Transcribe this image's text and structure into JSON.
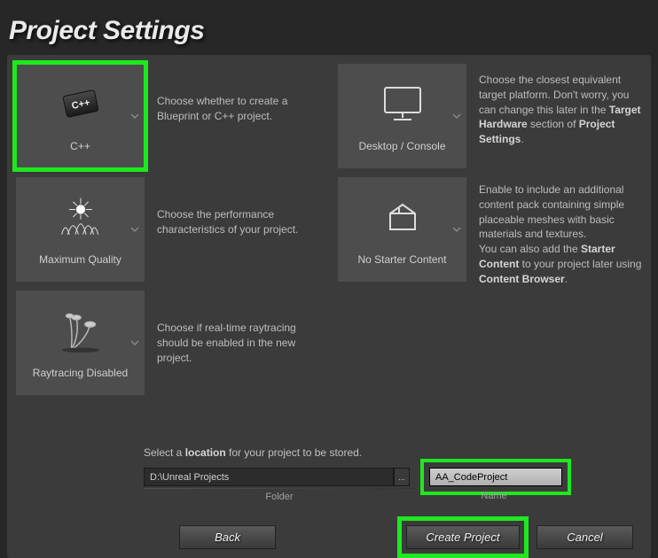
{
  "title": "Project Settings",
  "left": [
    {
      "label": "C++",
      "desc": "Choose whether to create a Blueprint or C++ project.",
      "highlight": true
    },
    {
      "label": "Maximum Quality",
      "desc": "Choose the performance characteristics of your project."
    },
    {
      "label": "Raytracing Disabled",
      "desc": "Choose if real-time raytracing should be enabled in the new project."
    }
  ],
  "right": [
    {
      "label": "Desktop / Console",
      "desc_parts": [
        "Choose the closest equivalent target platform. Don't worry, you can change this later in the ",
        "Target Hardware",
        " section of ",
        "Project Settings",
        "."
      ]
    },
    {
      "label": "No Starter Content",
      "desc_parts": [
        "Enable to include an additional content pack containing simple placeable meshes with basic materials and textures.\nYou can also add the ",
        "Starter Content",
        " to your project later using ",
        "Content Browser",
        "."
      ]
    }
  ],
  "location_prompt_pre": "Select a ",
  "location_prompt_bold": "location",
  "location_prompt_post": " for your project to be stored.",
  "folder_value": "D:\\Unreal Projects",
  "folder_label": "Folder",
  "browse_label": "...",
  "name_value": "AA_CodeProject",
  "name_label": "Name",
  "buttons": {
    "back": "Back",
    "create": "Create Project",
    "cancel": "Cancel"
  }
}
